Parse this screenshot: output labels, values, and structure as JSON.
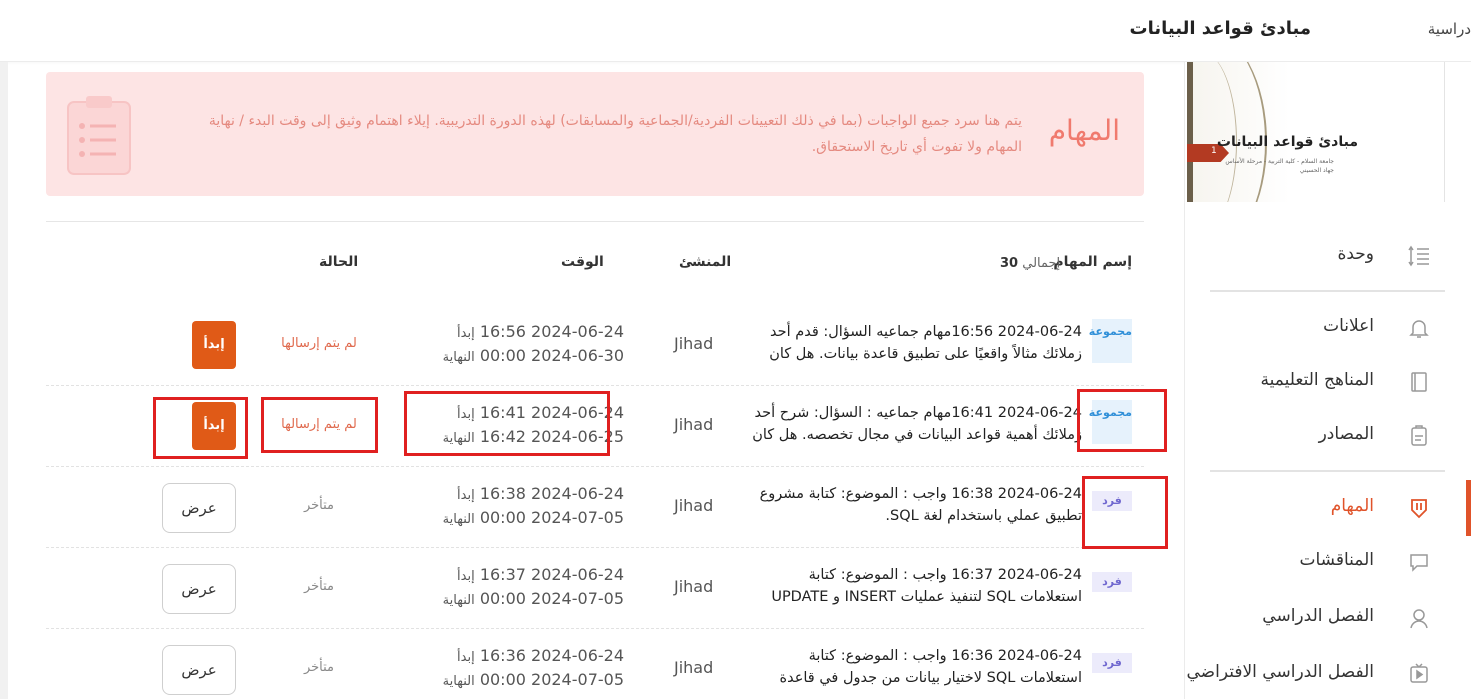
{
  "header": {
    "course_title": "مبادئ قواعد البيانات",
    "breadcrumb": "دراسية"
  },
  "sidebar": {
    "cover": {
      "title": "مبادئ قواعد البيانات",
      "subtitle1": "جامعة السلام - كلية التربية - مرحلة الأساس",
      "subtitle2": "جهاد الحسيني",
      "tag": "1"
    },
    "items": [
      {
        "label": "وحدة",
        "icon": "unit-list-icon"
      },
      {
        "label": "اعلانات",
        "icon": "bell-icon"
      },
      {
        "label": "المناهج التعليمية",
        "icon": "book-icon"
      },
      {
        "label": "المصادر",
        "icon": "resources-icon"
      },
      {
        "label": "المهام",
        "icon": "tasks-shield-icon",
        "active": true
      },
      {
        "label": "المناقشات",
        "icon": "chat-icon"
      },
      {
        "label": "الفصل الدراسي",
        "icon": "user-icon"
      },
      {
        "label": "الفصل الدراسي الافتراضي",
        "icon": "video-icon"
      }
    ],
    "accent": "#e0532a"
  },
  "banner": {
    "title": "المهام",
    "text": "يتم هنا سرد جميع الواجبات (بما في ذلك التعيينات الفردية/الجماعية والمسابقات) لهذه الدورة التدريبية. إيلاء اهتمام وثيق إلى وقت البدء / نهاية المهام ولا تفوت أي تاريخ الاستحقاق."
  },
  "table": {
    "headers": {
      "name": "إسم المهام",
      "creator": "المنشئ",
      "time": "الوقت",
      "status": "الحالة"
    },
    "total_label": "إجمالي",
    "total": "30",
    "rows": [
      {
        "badge": "مجموعة",
        "badge_type": "group",
        "name": "2024-06-24 16:56مهام جماعيه السؤال: قدم أحد زملائك مثالاً واقعيًا على تطبيق قاعدة بيانات. هل كان المثال",
        "creator": "Jihad",
        "start": "2024-06-24 16:56",
        "start_label": "إبدأ",
        "end": "2024-06-30 00:00",
        "end_label": "النهاية",
        "status": "لم يتم إرسالها",
        "action": "إبدأ",
        "action_type": "start"
      },
      {
        "badge": "مجموعة",
        "badge_type": "group",
        "name": "2024-06-24 16:41مهام جماعيه : السؤال: شرح أحد زملائك أهمية قواعد البيانات في مجال تخصصه. هل كان",
        "creator": "Jihad",
        "start": "2024-06-24 16:41",
        "start_label": "إبدأ",
        "end": "2024-06-25 16:42",
        "end_label": "النهاية",
        "status": "لم يتم إرسالها",
        "action": "إبدأ",
        "action_type": "start"
      },
      {
        "badge": "فرد",
        "badge_type": "indiv",
        "name": "2024-06-24 16:38 واجب : الموضوع: كتابة مشروع تطبيق عملي باستخدام لغة SQL.",
        "creator": "Jihad",
        "start": "2024-06-24 16:38",
        "start_label": "إبدأ",
        "end": "2024-07-05 00:00",
        "end_label": "النهاية",
        "status": "متأخر",
        "action": "عرض",
        "action_type": "view"
      },
      {
        "badge": "فرد",
        "badge_type": "indiv",
        "name": "2024-06-24 16:37 واجب : الموضوع: كتابة استعلامات SQL لتنفيذ عمليات INSERT و UPDATE",
        "creator": "Jihad",
        "start": "2024-06-24 16:37",
        "start_label": "إبدأ",
        "end": "2024-07-05 00:00",
        "end_label": "النهاية",
        "status": "متأخر",
        "action": "عرض",
        "action_type": "view"
      },
      {
        "badge": "فرد",
        "badge_type": "indiv",
        "name": "2024-06-24 16:36 واجب : الموضوع: كتابة استعلامات SQL لاختيار بيانات من جدول في قاعدة بيانات.",
        "creator": "Jihad",
        "start": "2024-06-24 16:36",
        "start_label": "إبدأ",
        "end": "2024-07-05 00:00",
        "end_label": "النهاية",
        "status": "متأخر",
        "action": "عرض",
        "action_type": "view"
      }
    ]
  }
}
